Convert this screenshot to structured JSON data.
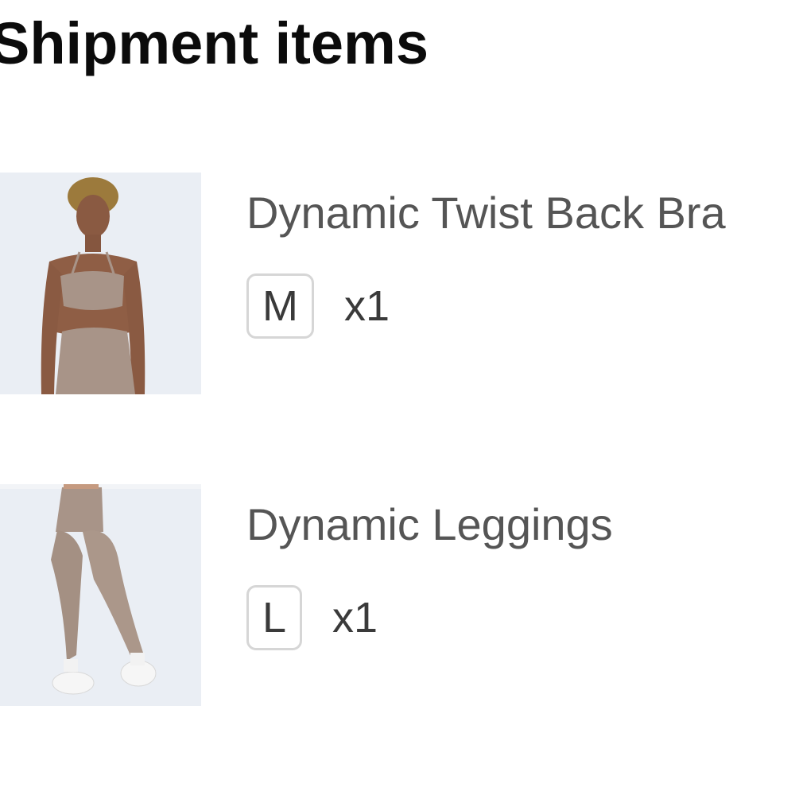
{
  "header": {
    "title": "Shipment items"
  },
  "items": [
    {
      "name": "Dynamic Twist Back Bra",
      "size": "M",
      "quantity": "x1",
      "image": "model-wearing-bra-photo"
    },
    {
      "name": "Dynamic Leggings",
      "size": "L",
      "quantity": "x1",
      "image": "model-wearing-leggings-photo"
    }
  ],
  "colors": {
    "title": "#0b0b0b",
    "item_text": "#555555",
    "badge_border": "#d6d6d6",
    "product_color": "#a89488",
    "image_background": "#e9eef5"
  }
}
